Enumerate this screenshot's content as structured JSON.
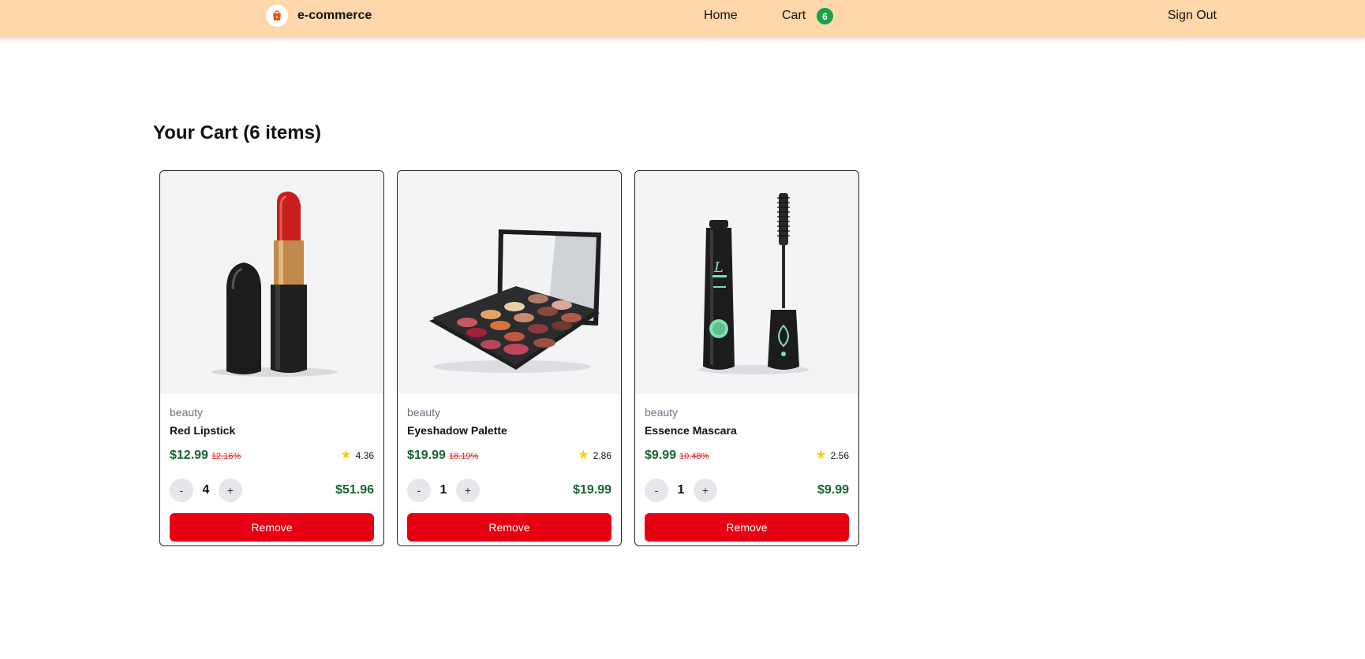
{
  "nav": {
    "brand": "e-commerce",
    "home": "Home",
    "cart": "Cart",
    "cart_count": "6",
    "sign_out": "Sign Out"
  },
  "page": {
    "title": "Your Cart (6 items)"
  },
  "items": [
    {
      "category": "beauty",
      "name": "Red Lipstick",
      "price": "$12.99",
      "discount": "12.16%",
      "rating": "4.36",
      "qty": "4",
      "subtotal": "$51.96",
      "minus": "-",
      "plus": "+",
      "remove": "Remove"
    },
    {
      "category": "beauty",
      "name": "Eyeshadow Palette",
      "price": "$19.99",
      "discount": "18.19%",
      "rating": "2.86",
      "qty": "1",
      "subtotal": "$19.99",
      "minus": "-",
      "plus": "+",
      "remove": "Remove"
    },
    {
      "category": "beauty",
      "name": "Essence Mascara",
      "price": "$9.99",
      "discount": "10.48%",
      "rating": "2.56",
      "qty": "1",
      "subtotal": "$9.99",
      "minus": "-",
      "plus": "+",
      "remove": "Remove"
    }
  ],
  "colors": {
    "navbar": "#fed7aa",
    "badge": "#16a34a",
    "price": "#166534",
    "remove": "#e60012",
    "star": "#facc15"
  }
}
